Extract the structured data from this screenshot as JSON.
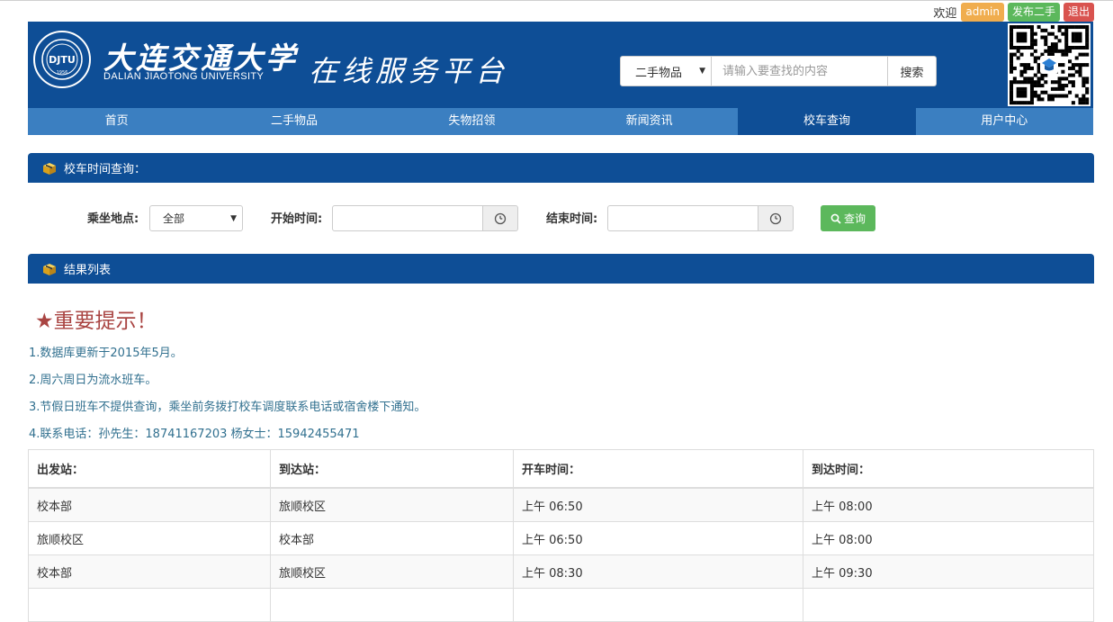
{
  "topbar": {
    "welcome": "欢迎",
    "user": "admin",
    "publish": "发布二手",
    "logout": "退出"
  },
  "header": {
    "university_cn": "大连交通大学",
    "university_en": "DALIAN JIAOTONG UNIVERSITY",
    "logo_year": "1956",
    "logo_mark": "DJTU",
    "platform": "在线服务平台",
    "search": {
      "category": "二手物品",
      "placeholder": "请输入要查找的内容",
      "button": "搜索"
    }
  },
  "nav": {
    "items": [
      "首页",
      "二手物品",
      "失物招领",
      "新闻资讯",
      "校车查询",
      "用户中心"
    ],
    "active": "校车查询"
  },
  "query": {
    "section_title": "校车时间查询：",
    "location_label": "乘坐地点:",
    "location_value": "全部",
    "start_label": "开始时间:",
    "end_label": "结束时间:",
    "button": "查询"
  },
  "results": {
    "section_title": "结果列表",
    "notice_title": "★重要提示！",
    "notices": [
      "1.数据库更新于2015年5月。",
      "2.周六周日为流水班车。",
      "3.节假日班车不提供查询，乘坐前务拨打校车调度联系电话或宿舍楼下通知。",
      "4.联系电话：孙先生：18741167203 杨女士：15942455471"
    ],
    "table": {
      "headers": [
        "出发站：",
        "到达站：",
        "开车时间：",
        "到达时间："
      ],
      "rows": [
        [
          "校本部",
          "旅顺校区",
          "上午 06:50",
          "上午 08:00"
        ],
        [
          "旅顺校区",
          "校本部",
          "上午 06:50",
          "上午 08:00"
        ],
        [
          "校本部",
          "旅顺校区",
          "上午 08:30",
          "上午 09:30"
        ]
      ]
    }
  },
  "colors": {
    "primary": "#0e4e96",
    "nav": "#3b7fc1",
    "success": "#5cb85c",
    "warning": "#f0ad4e",
    "danger": "#d9534f",
    "notice_title": "#a94442",
    "notice_text": "#31708f"
  }
}
